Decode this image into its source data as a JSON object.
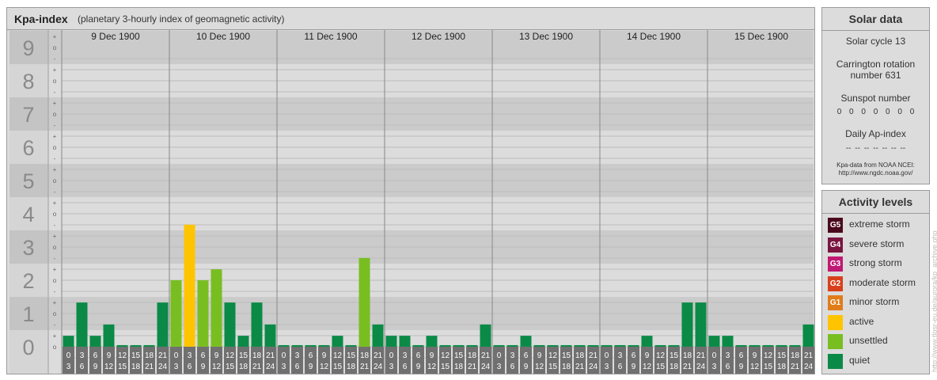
{
  "header": {
    "title": "Kpa-index",
    "subtitle": "(planetary 3-hourly index of geomagnetic activity)"
  },
  "chart_data": {
    "type": "bar",
    "title": "Kpa-index",
    "subtitle": "(planetary 3-hourly index of geomagnetic activity)",
    "ylim": [
      0,
      9
    ],
    "y_ticks": [
      "0",
      "1",
      "2",
      "3",
      "4",
      "5",
      "6",
      "7",
      "8",
      "9"
    ],
    "sub_ticks": [
      "+",
      "o",
      "-"
    ],
    "days": [
      "9 Dec 1900",
      "10 Dec 1900",
      "11 Dec 1900",
      "12 Dec 1900",
      "13 Dec 1900",
      "14 Dec 1900",
      "15 Dec 1900"
    ],
    "interval_labels": [
      [
        "0",
        "3"
      ],
      [
        "3",
        "6"
      ],
      [
        "6",
        "9"
      ],
      [
        "9",
        "12"
      ],
      [
        "12",
        "15"
      ],
      [
        "15",
        "18"
      ],
      [
        "18",
        "21"
      ],
      [
        "21",
        "24"
      ]
    ],
    "values": [
      0.33,
      1.33,
      0.33,
      0.67,
      0,
      0,
      0,
      1.33,
      2,
      3.67,
      2,
      2.33,
      1.33,
      0.33,
      1.33,
      0.67,
      0,
      0,
      0,
      0,
      0.33,
      0,
      2.67,
      0.67,
      0.33,
      0.33,
      0,
      0.33,
      0,
      0,
      0,
      0.67,
      0,
      0,
      0.33,
      0,
      0,
      0,
      0,
      0,
      0,
      0,
      0,
      0.33,
      0,
      0,
      1.33,
      1.33,
      0.33,
      0.33,
      0,
      0,
      0,
      0,
      0,
      0.67
    ],
    "grid": true
  },
  "colors": {
    "quiet": "#0a8a46",
    "unsettled": "#78be21",
    "active": "#ffc400",
    "minor": "#e07c1a",
    "moderate": "#d8401c",
    "strong": "#c01873",
    "severe": "#7a1540",
    "extreme": "#4a0a1e",
    "band_dark": "#cbcbcb",
    "band_light": "#dcdcdc",
    "label_bg": "#707070"
  },
  "solar": {
    "title": "Solar data",
    "cycle": "Solar cycle 13",
    "carrington": "Carrington rotation number 631",
    "sunspot_label": "Sunspot number",
    "sunspot_values": "0 0 0 0 0 0 0",
    "ap_label": "Daily Ap-index",
    "ap_values": "-- -- -- -- -- -- --",
    "source_line1": "Kpa-data from NOAA NCEI:",
    "source_line2": "http://www.ngdc.noaa.gov/"
  },
  "activity": {
    "title": "Activity levels",
    "levels": [
      {
        "badge": "G5",
        "label": "extreme storm",
        "color": "#4a0a1e"
      },
      {
        "badge": "G4",
        "label": "severe storm",
        "color": "#7a1540"
      },
      {
        "badge": "G3",
        "label": "strong storm",
        "color": "#c01873"
      },
      {
        "badge": "G2",
        "label": "moderate storm",
        "color": "#d8401c"
      },
      {
        "badge": "G1",
        "label": "minor storm",
        "color": "#e07c1a"
      },
      {
        "badge": "",
        "label": "active",
        "color": "#ffc400"
      },
      {
        "badge": "",
        "label": "unsettled",
        "color": "#78be21"
      },
      {
        "badge": "",
        "label": "quiet",
        "color": "#0a8a46"
      }
    ]
  },
  "watermark": "http://www.tlpsr-eu.de/aurora/kp_archive.php"
}
